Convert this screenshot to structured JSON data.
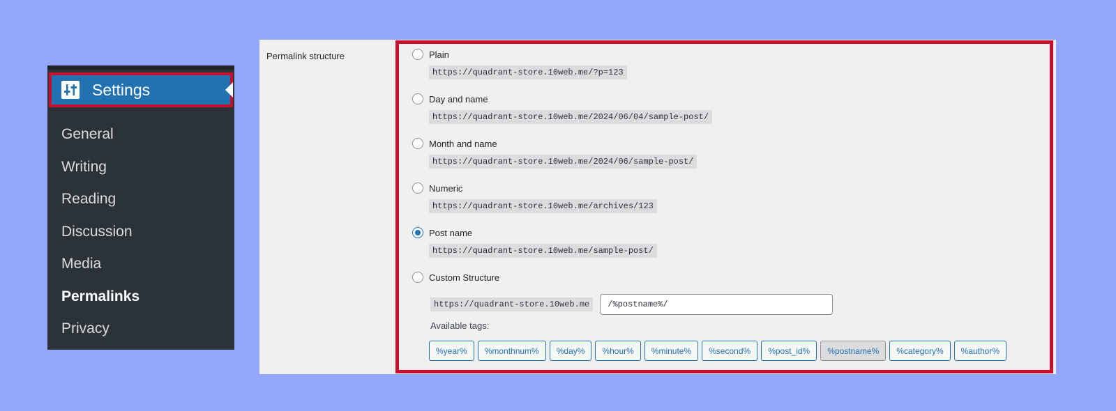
{
  "sidebar": {
    "header_label": "Settings",
    "items": [
      {
        "label": "General",
        "active": false
      },
      {
        "label": "Writing",
        "active": false
      },
      {
        "label": "Reading",
        "active": false
      },
      {
        "label": "Discussion",
        "active": false
      },
      {
        "label": "Media",
        "active": false
      },
      {
        "label": "Permalinks",
        "active": true
      },
      {
        "label": "Privacy",
        "active": false
      }
    ]
  },
  "permalink": {
    "row_label": "Permalink structure",
    "options": [
      {
        "label": "Plain",
        "example": "https://quadrant-store.10web.me/?p=123",
        "checked": false
      },
      {
        "label": "Day and name",
        "example": "https://quadrant-store.10web.me/2024/06/04/sample-post/",
        "checked": false
      },
      {
        "label": "Month and name",
        "example": "https://quadrant-store.10web.me/2024/06/sample-post/",
        "checked": false
      },
      {
        "label": "Numeric",
        "example": "https://quadrant-store.10web.me/archives/123",
        "checked": false
      },
      {
        "label": "Post name",
        "example": "https://quadrant-store.10web.me/sample-post/",
        "checked": true
      },
      {
        "label": "Custom Structure",
        "checked": false
      }
    ],
    "custom": {
      "base": "https://quadrant-store.10web.me",
      "value": "/%postname%/"
    },
    "available_tags_label": "Available tags:",
    "tags": [
      {
        "label": "%year%",
        "active": false
      },
      {
        "label": "%monthnum%",
        "active": false
      },
      {
        "label": "%day%",
        "active": false
      },
      {
        "label": "%hour%",
        "active": false
      },
      {
        "label": "%minute%",
        "active": false
      },
      {
        "label": "%second%",
        "active": false
      },
      {
        "label": "%post_id%",
        "active": false
      },
      {
        "label": "%postname%",
        "active": true
      },
      {
        "label": "%category%",
        "active": false
      },
      {
        "label": "%author%",
        "active": false
      }
    ]
  },
  "colors": {
    "background": "#93a8fa",
    "sidebar": "#2c3338",
    "accent": "#2271b1",
    "highlight_border": "#c8102e"
  }
}
